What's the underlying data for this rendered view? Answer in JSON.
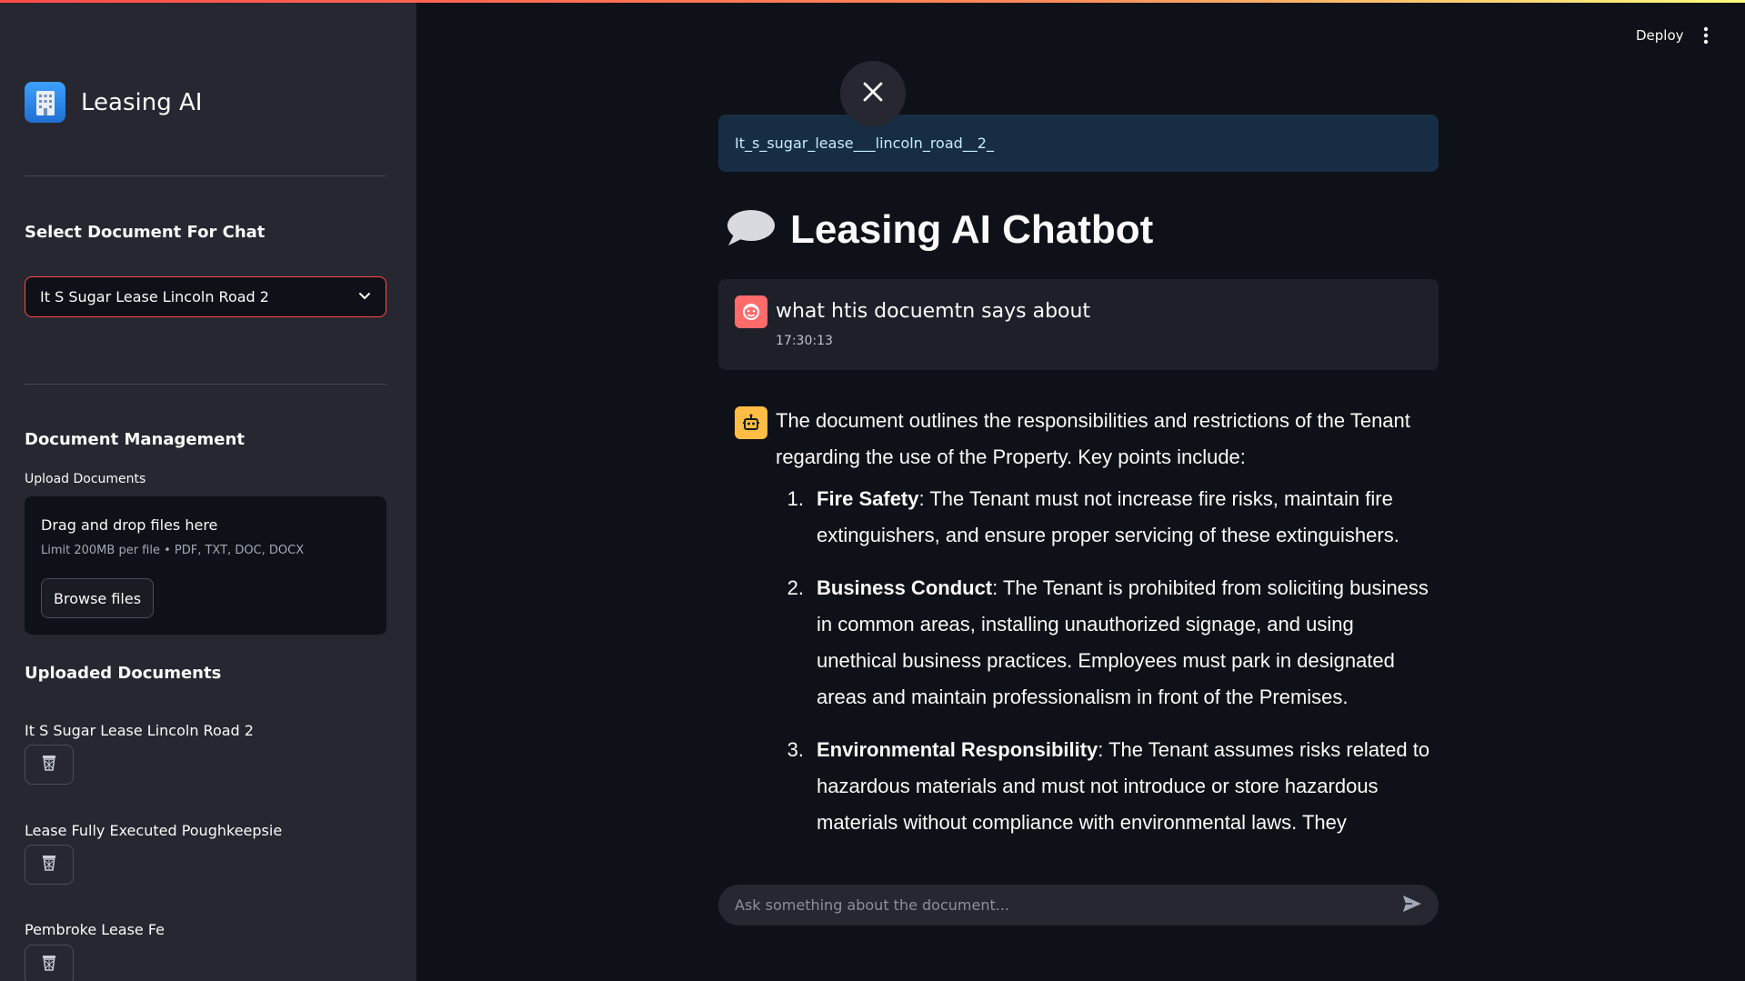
{
  "sidebar": {
    "app_title": "Leasing AI",
    "select_heading": "Select Document For Chat",
    "selected_document": "It S Sugar Lease Lincoln Road 2",
    "management_heading": "Document Management",
    "upload_label": "Upload Documents",
    "dropzone": {
      "title": "Drag and drop files here",
      "limit": "Limit 200MB per file • PDF, TXT, DOC, DOCX",
      "browse_label": "Browse files"
    },
    "uploaded_heading": "Uploaded Documents",
    "documents": [
      {
        "name": "It S Sugar Lease Lincoln Road 2"
      },
      {
        "name": "Lease Fully Executed Poughkeepsie"
      },
      {
        "name": "Pembroke Lease Fe"
      }
    ]
  },
  "header": {
    "deploy_label": "Deploy"
  },
  "main": {
    "document_banner": "It_s_sugar_lease___lincoln_road__2_",
    "title": "Leasing AI Chatbot",
    "user_message": {
      "text": "what htis docuemtn says about",
      "time": "17:30:13"
    },
    "bot_message": {
      "intro": "The document outlines the responsibilities and restrictions of the Tenant regarding the use of the Property. Key points include:",
      "items": [
        {
          "num": "1.",
          "title": "Fire Safety",
          "text": ": The Tenant must not increase fire risks, maintain fire extinguishers, and ensure proper servicing of these extinguishers."
        },
        {
          "num": "2.",
          "title": "Business Conduct",
          "text": ": The Tenant is prohibited from soliciting business in common areas, installing unauthorized signage, and using unethical business practices. Employees must park in designated areas and maintain professionalism in front of the Premises."
        },
        {
          "num": "3.",
          "title": "Environmental Responsibility",
          "text": ": The Tenant assumes risks related to hazardous materials and must not introduce or store hazardous materials without compliance with environmental laws. They"
        }
      ]
    },
    "chat_input_placeholder": "Ask something about the document..."
  },
  "colors": {
    "accent": "#ff4b4b",
    "sidebar_bg": "#262730",
    "main_bg": "#0e1117",
    "banner_bg": "#172d43",
    "user_avatar": "#ff6b6b",
    "bot_avatar": "#ffbd45"
  },
  "icons": {
    "brand": "building-icon",
    "select": "chevron-down-icon",
    "delete": "trash-icon",
    "close": "close-icon",
    "title": "speech-bubble-icon",
    "user": "user-avatar-icon",
    "bot": "robot-icon",
    "send": "send-icon",
    "menu": "more-vertical-icon"
  }
}
